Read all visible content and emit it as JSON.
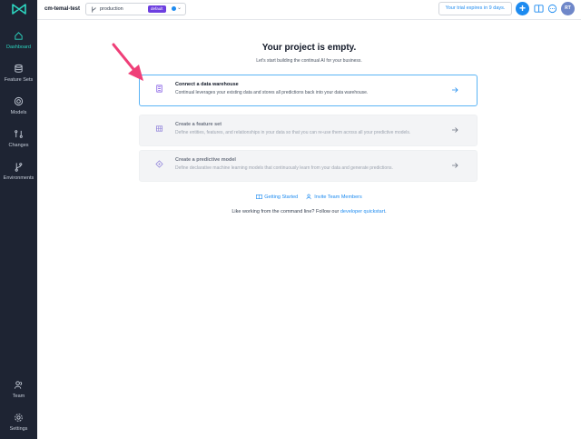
{
  "sidebar": {
    "items": [
      {
        "label": "Dashboard",
        "icon": "home-icon",
        "active": true
      },
      {
        "label": "Feature Sets",
        "icon": "database-icon"
      },
      {
        "label": "Models",
        "icon": "target-icon"
      },
      {
        "label": "Changes",
        "icon": "branch-compare-icon"
      },
      {
        "label": "Environments",
        "icon": "git-branch-icon"
      },
      {
        "label": "Team",
        "icon": "users-icon"
      },
      {
        "label": "Settings",
        "icon": "gear-icon"
      }
    ]
  },
  "header": {
    "project": "cm-temal-test",
    "branch": "production",
    "badge": "default",
    "trial": "Your trial expires in 9 days.",
    "avatar": "RT"
  },
  "main": {
    "title": "Your project is empty.",
    "subtitle": "Let's start building the continual AI for your business.",
    "cards": [
      {
        "title": "Connect a data warehouse",
        "desc": "Continual leverages your existing data and stores all predictions back into your data warehouse."
      },
      {
        "title": "Create a feature set",
        "desc": "Define entities, features, and relationships in your data so that you can re-use them across all your predictive models."
      },
      {
        "title": "Create a predictive model",
        "desc": "Define declarative machine learning models that continuously learn from your data and generate predictions."
      }
    ],
    "links": {
      "getting_started": "Getting Started",
      "invite": "Invite Team Members"
    },
    "cli": {
      "prefix": "Like working from the command line? Follow our",
      "link": "developer quickstart",
      "suffix": "."
    }
  },
  "colors": {
    "sidebar": "#1e2433",
    "accent": "#1d8bf0",
    "teal": "#2dd4bf",
    "badge": "#6d3fe0",
    "arrow": "#ef3f78"
  }
}
